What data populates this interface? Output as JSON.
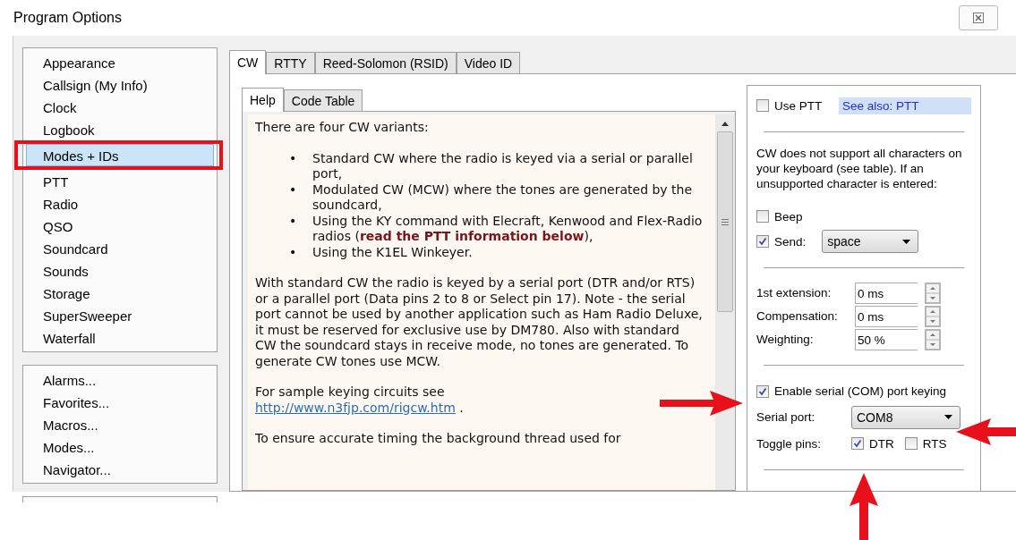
{
  "window": {
    "title": "Program Options"
  },
  "sidebar": {
    "groups": [
      {
        "items": [
          {
            "label": "Appearance",
            "selected": false,
            "highlighted": false
          },
          {
            "label": "Callsign (My Info)",
            "selected": false,
            "highlighted": false
          },
          {
            "label": "Clock",
            "selected": false,
            "highlighted": false
          },
          {
            "label": "Logbook",
            "selected": false,
            "highlighted": false
          },
          {
            "label": "Modes + IDs",
            "selected": true,
            "highlighted": true
          },
          {
            "label": "PTT",
            "selected": false,
            "highlighted": false
          },
          {
            "label": "Radio",
            "selected": false,
            "highlighted": false
          },
          {
            "label": "QSO",
            "selected": false,
            "highlighted": false
          },
          {
            "label": "Soundcard",
            "selected": false,
            "highlighted": false
          },
          {
            "label": "Sounds",
            "selected": false,
            "highlighted": false
          },
          {
            "label": "Storage",
            "selected": false,
            "highlighted": false
          },
          {
            "label": "SuperSweeper",
            "selected": false,
            "highlighted": false
          },
          {
            "label": "Waterfall",
            "selected": false,
            "highlighted": false
          }
        ]
      },
      {
        "items": [
          {
            "label": "Alarms...",
            "selected": false,
            "highlighted": false
          },
          {
            "label": "Favorites...",
            "selected": false,
            "highlighted": false
          },
          {
            "label": "Macros...",
            "selected": false,
            "highlighted": false
          },
          {
            "label": "Modes...",
            "selected": false,
            "highlighted": false
          },
          {
            "label": "Navigator...",
            "selected": false,
            "highlighted": false
          }
        ]
      }
    ]
  },
  "tabs": [
    {
      "label": "CW",
      "selected": true
    },
    {
      "label": "RTTY",
      "selected": false
    },
    {
      "label": "Reed-Solomon (RSID)",
      "selected": false
    },
    {
      "label": "Video ID",
      "selected": false
    }
  ],
  "help_tabs": [
    {
      "label": "Help",
      "selected": true
    },
    {
      "label": "Code Table",
      "selected": false
    }
  ],
  "help": {
    "intro": "There are four CW variants:",
    "bullets": [
      {
        "marker": "•",
        "text": "Standard CW where the radio is keyed via a serial or parallel port,"
      },
      {
        "marker": "•",
        "text": "Modulated CW (MCW) where the tones are generated by the soundcard,"
      },
      {
        "marker": "•",
        "text": "Using the KY command with Elecraft, Kenwood and Flex-Radio radios (**read the PTT information below**),"
      },
      {
        "marker": "•",
        "text": "Using the K1EL Winkeyer."
      }
    ],
    "paragraphs": [
      {
        "text": "With standard CW the radio is keyed by a serial port (DTR and/or RTS) or a parallel port (Data pins 2 to 8 or Select pin 17). Note - the serial port cannot be used by another application such as Ham Radio Deluxe, it must be reserved for exclusive use by DM780. Also with standard CW the soundcard stays in receive mode, no tones are generated. To generate CW tones use MCW."
      },
      {
        "text": "For sample keying circuits see",
        "link": "http://www.n3fjp.com/rigcw.htm",
        "after": "."
      },
      {
        "text": "To ensure accurate timing the background thread used for"
      }
    ]
  },
  "options": {
    "use_ptt": {
      "label": "Use PTT",
      "checked": false
    },
    "see_also": "See also: PTT",
    "note": "CW does not support all characters on your keyboard (see table). If an unsupported character  is entered:",
    "beep": {
      "label": "Beep",
      "checked": false
    },
    "send": {
      "label": "Send:",
      "checked": true,
      "value": "space"
    },
    "spinners": [
      {
        "label": "1st extension:",
        "value": "0 ms"
      },
      {
        "label": "Compensation:",
        "value": "0 ms"
      },
      {
        "label": "Weighting:",
        "value": "50 %"
      }
    ],
    "serial_keying": {
      "label": "Enable serial (COM) port keying",
      "checked": true
    },
    "serial_port": {
      "label": "Serial port:",
      "value": "COM8"
    },
    "toggle_pins": {
      "label": "Toggle pins:",
      "pins": [
        {
          "label": "DTR",
          "checked": true
        },
        {
          "label": "RTS",
          "checked": false
        }
      ]
    }
  }
}
